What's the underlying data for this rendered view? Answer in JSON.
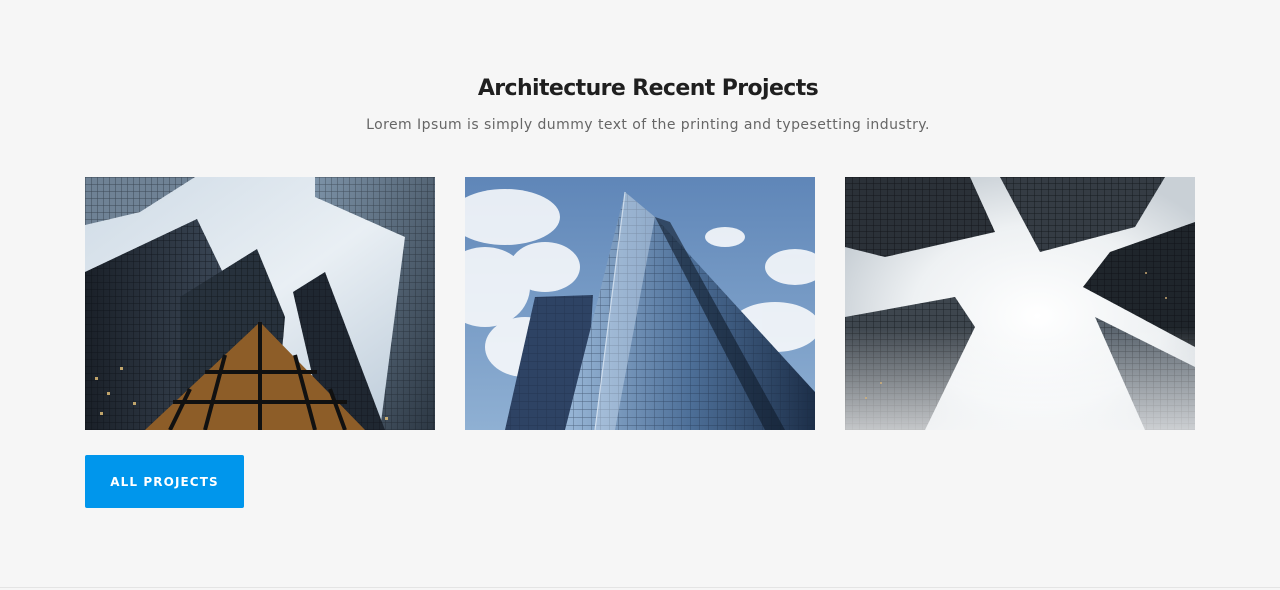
{
  "section": {
    "title": "Architecture Recent Projects",
    "subtitle": "Lorem Ipsum is simply dummy text of the printing and typesetting industry."
  },
  "projects": [
    {
      "image": "skyscrapers-looking-up-dark-glass"
    },
    {
      "image": "glass-tower-blue-sky-clouds"
    },
    {
      "image": "towers-converging-into-fog"
    }
  ],
  "cta": {
    "label": "ALL PROJECTS",
    "color": "#0096ec"
  },
  "colors": {
    "background": "#f6f6f6",
    "heading": "#1f1f1f",
    "body_text": "#666666"
  }
}
